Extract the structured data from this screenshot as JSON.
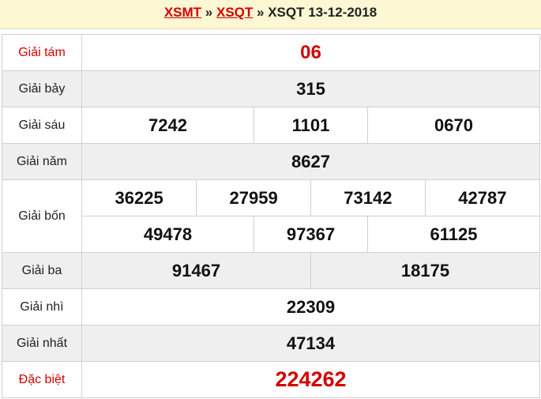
{
  "header": {
    "link1": "XSMT",
    "sep1": " » ",
    "link2": "XSQT",
    "sep2": " » ",
    "current": "XSQT 13-12-2018"
  },
  "prizes": {
    "g8": {
      "label": "Giải tám",
      "values": [
        "06"
      ]
    },
    "g7": {
      "label": "Giải bảy",
      "values": [
        "315"
      ]
    },
    "g6": {
      "label": "Giải sáu",
      "values": [
        "7242",
        "1101",
        "0670"
      ]
    },
    "g5": {
      "label": "Giải năm",
      "values": [
        "8627"
      ]
    },
    "g4": {
      "label": "Giải bốn",
      "row1": [
        "36225",
        "27959",
        "73142",
        "42787"
      ],
      "row2": [
        "49478",
        "97367",
        "61125"
      ]
    },
    "g3": {
      "label": "Giải ba",
      "values": [
        "91467",
        "18175"
      ]
    },
    "g2": {
      "label": "Giải nhì",
      "values": [
        "22309"
      ]
    },
    "g1": {
      "label": "Giải nhất",
      "values": [
        "47134"
      ]
    },
    "db": {
      "label": "Đặc biệt",
      "values": [
        "224262"
      ]
    }
  },
  "colors": {
    "accent_red": "#d40000",
    "header_bg": "#fdf7d3",
    "row_gray": "#efefef",
    "border": "#d0d0d0"
  }
}
